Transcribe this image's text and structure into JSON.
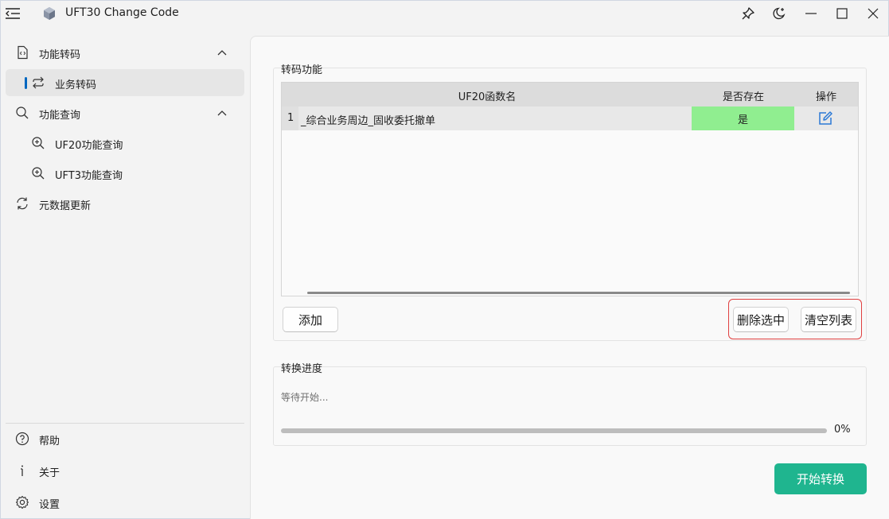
{
  "titlebar": {
    "title": "UFT30 Change Code",
    "icons": [
      "menu-icon",
      "cube-logo-icon",
      "pin-icon",
      "theme-moon-icon",
      "minimize-icon",
      "maximize-icon",
      "close-icon"
    ]
  },
  "sidebar": {
    "items": [
      {
        "label": "功能转码",
        "icon": "code-file-icon",
        "expanded": true
      },
      {
        "label": "业务转码",
        "icon": "swap-arrows-icon",
        "selected": true
      },
      {
        "label": "功能查询",
        "icon": "search-icon",
        "expanded": true
      },
      {
        "label": "UF20功能查询",
        "icon": "zoom-in-icon"
      },
      {
        "label": "UFT3功能查询",
        "icon": "zoom-in-icon"
      },
      {
        "label": "元数据更新",
        "icon": "refresh-icon"
      }
    ],
    "footer": [
      {
        "label": "帮助",
        "icon": "help-circle-icon"
      },
      {
        "label": "关于",
        "icon": "info-icon"
      },
      {
        "label": "设置",
        "icon": "gear-icon"
      }
    ]
  },
  "transcode": {
    "group_title": "转码功能",
    "columns": {
      "name": "UF20函数名",
      "exists": "是否存在",
      "op": "操作"
    },
    "rows": [
      {
        "index": "1",
        "name": "_综合业务周边_固收委托撤单",
        "exists": "是"
      }
    ],
    "add_label": "添加",
    "delete_selected_label": "删除选中",
    "clear_list_label": "清空列表"
  },
  "progress": {
    "group_title": "转换进度",
    "status": "等待开始...",
    "value": 0,
    "percent_label": "0%"
  },
  "start_button_label": "开始转换",
  "colors": {
    "accent": "#0067c0",
    "exists_bg": "#90ee90",
    "primary_button": "#1fb58f",
    "highlight_border": "#e04040"
  }
}
